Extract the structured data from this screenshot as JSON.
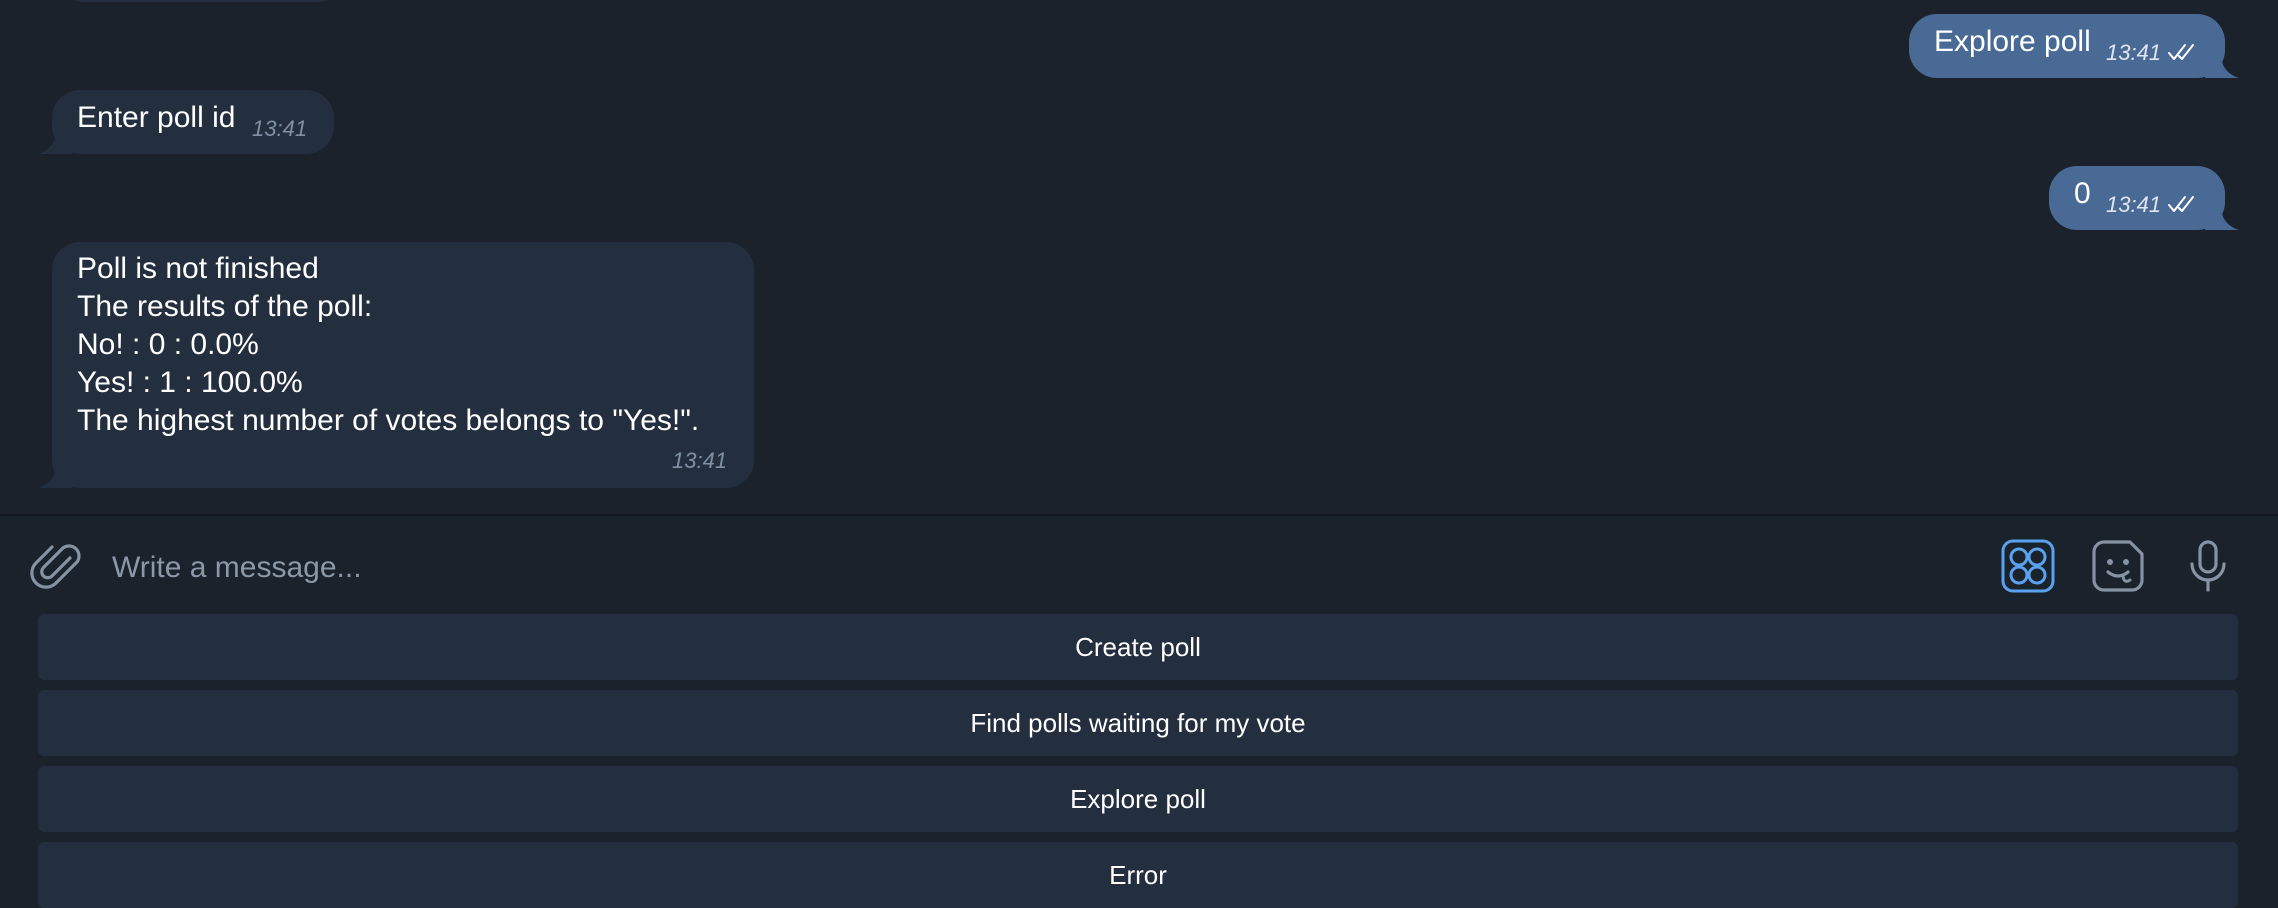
{
  "colors": {
    "chat_background": "#1b222c",
    "incoming_bubble": "#232f3e",
    "outgoing_bubble": "#4a6a96",
    "keyboard_button": "#232f3e",
    "accent": "#5aa1f0"
  },
  "messages": [
    {
      "direction": "outgoing",
      "text": "Explore poll",
      "time": "13:41",
      "status": "read"
    },
    {
      "direction": "incoming",
      "text": "Enter poll id",
      "time": "13:41"
    },
    {
      "direction": "outgoing",
      "text": "0",
      "time": "13:41",
      "status": "read"
    },
    {
      "direction": "incoming",
      "lines": [
        "Poll is not finished",
        "The results of the poll:",
        "No! : 0 : 0.0%",
        "Yes! : 1 : 100.0%",
        "The highest number of votes belongs to \"Yes!\"."
      ],
      "time": "13:41"
    }
  ],
  "composer": {
    "placeholder": "Write a message...",
    "icons": [
      "paperclip-icon",
      "bot-keyboard-icon",
      "sticker-icon",
      "microphone-icon"
    ]
  },
  "keyboard": {
    "buttons": [
      "Create poll",
      "Find polls waiting for my vote",
      "Explore poll",
      "Error"
    ]
  }
}
